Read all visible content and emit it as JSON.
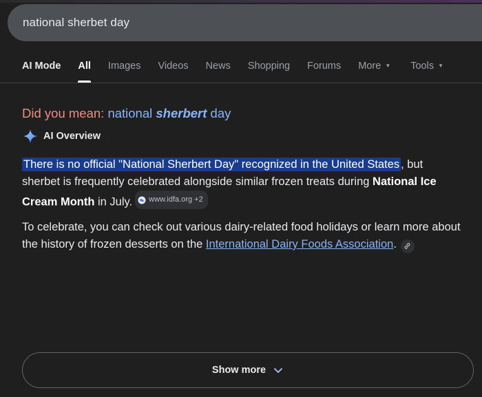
{
  "search": {
    "query": "national sherbet day"
  },
  "tabs": [
    {
      "label": "AI Mode"
    },
    {
      "label": "All"
    },
    {
      "label": "Images"
    },
    {
      "label": "Videos"
    },
    {
      "label": "News"
    },
    {
      "label": "Shopping"
    },
    {
      "label": "Forums"
    },
    {
      "label": "More"
    },
    {
      "label": "Tools"
    }
  ],
  "did_you_mean": {
    "label": "Did you mean:",
    "before": "national ",
    "corrected": "sherbert",
    "after": " day"
  },
  "ai_overview": {
    "title": "AI Overview",
    "para1": {
      "highlight": "There is no official \"National Sherbert Day\" recognized in the United States",
      "middle": ", but sherbet is frequently celebrated alongside similar frozen treats during ",
      "bold": "National Ice Cream Month",
      "end": " in July.",
      "source_chip": "www.idfa.org +2"
    },
    "para2": {
      "text": "To celebrate, you can check out various dairy-related food holidays or learn more about the history of frozen desserts on the ",
      "link": "International Dairy Foods Association",
      "end": "."
    }
  },
  "show_more": {
    "label": "Show more"
  },
  "colors": {
    "background": "#1f1f1f",
    "search_box": "#4d5156",
    "highlight": "#1a3c8f",
    "link": "#8ab4f8",
    "did_you_mean": "#f28b82"
  },
  "icons": {
    "ai_overview": "sparkle-icon",
    "source_chip": "globe-icon",
    "link_icon": "link-icon",
    "show_more": "chevron-down-icon",
    "tab_caret": "caret-down-icon"
  }
}
